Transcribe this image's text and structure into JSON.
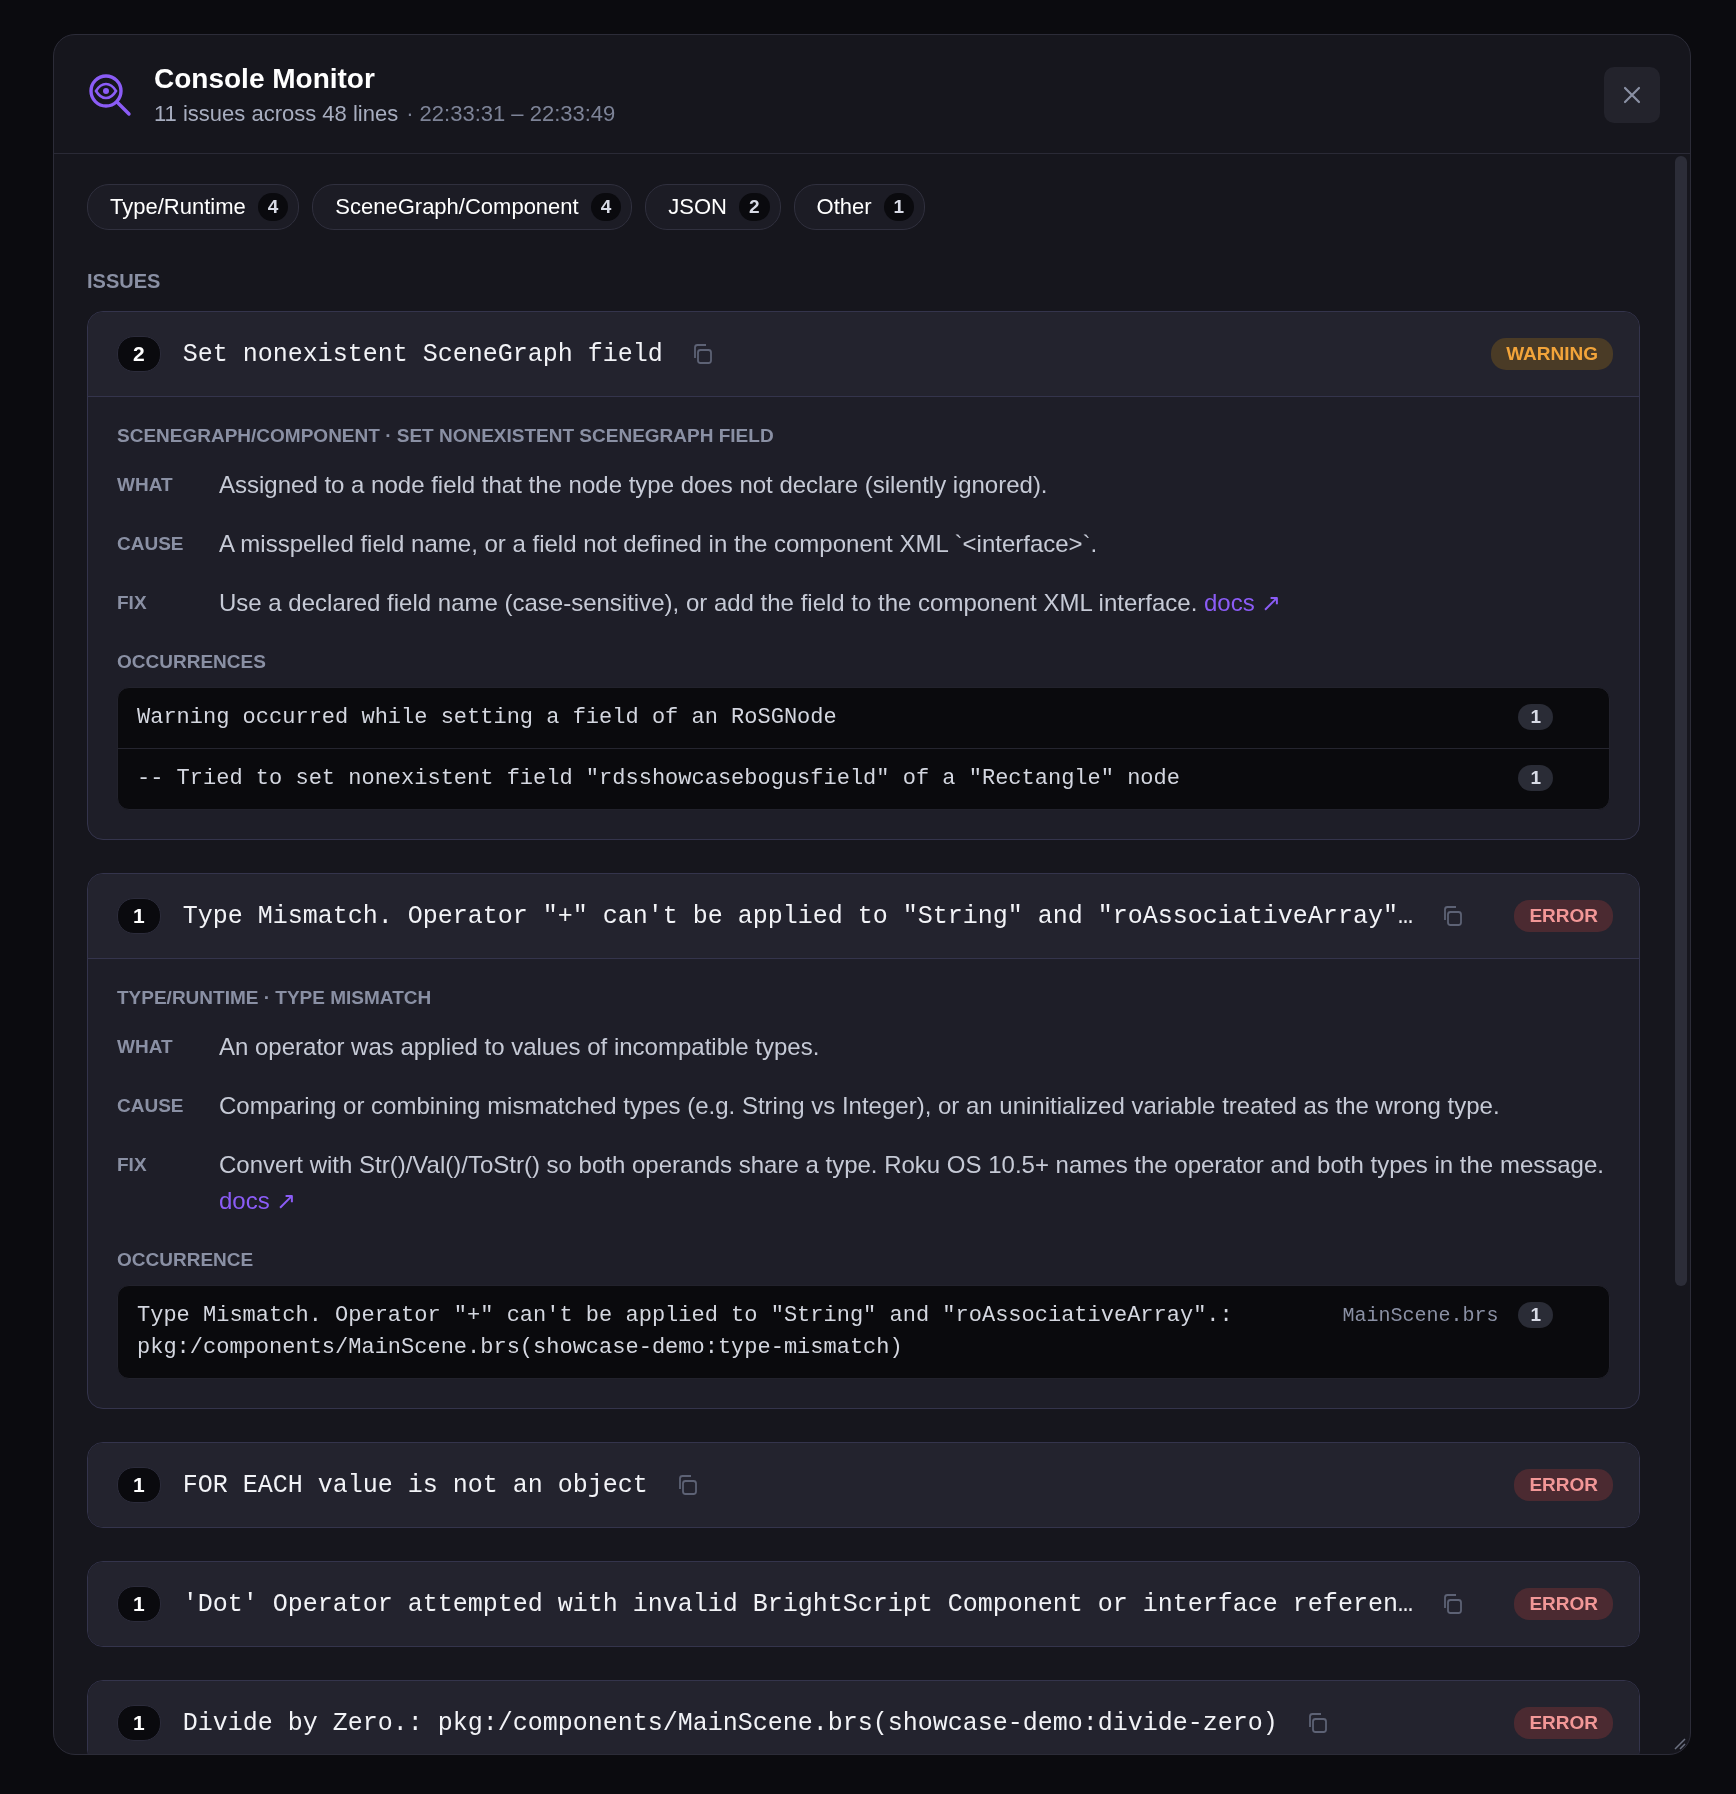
{
  "header": {
    "title": "Console Monitor",
    "summary": "11 issues across 48 lines",
    "time_range": "· 22:33:31 – 22:33:49"
  },
  "filters": [
    {
      "label": "Type/Runtime",
      "count": "4"
    },
    {
      "label": "SceneGraph/Component",
      "count": "4"
    },
    {
      "label": "JSON",
      "count": "2"
    },
    {
      "label": "Other",
      "count": "1"
    }
  ],
  "section_label": "ISSUES",
  "issues": [
    {
      "count": "2",
      "title": "Set nonexistent SceneGraph field",
      "kind": "warning",
      "severity": "WARNING",
      "expanded": true,
      "category": "SCENEGRAPH/COMPONENT · SET NONEXISTENT SCENEGRAPH FIELD",
      "details": [
        {
          "label": "WHAT",
          "text": "Assigned to a node field that the node type does not declare (silently ignored)."
        },
        {
          "label": "CAUSE",
          "text": "A misspelled field name, or a field not defined in the component XML `<interface>`."
        },
        {
          "label": "FIX",
          "text": "Use a declared field name (case-sensitive), or add the field to the component XML interface.",
          "link": "docs ↗"
        }
      ],
      "occurrences_label": "OCCURRENCES",
      "occurrences": [
        {
          "text": "Warning occurred while setting a field of an RoSGNode",
          "count": "1"
        },
        {
          "text": "-- Tried to set nonexistent field \"rdsshowcasebogusfield\" of a \"Rectangle\" node",
          "count": "1"
        }
      ]
    },
    {
      "count": "1",
      "title": "Type Mismatch. Operator \"+\" can't be applied to \"String\" and \"roAssociativeArray\"…",
      "kind": "error",
      "severity": "ERROR",
      "expanded": true,
      "category": "TYPE/RUNTIME · TYPE MISMATCH",
      "details": [
        {
          "label": "WHAT",
          "text": "An operator was applied to values of incompatible types."
        },
        {
          "label": "CAUSE",
          "text": "Comparing or combining mismatched types (e.g. String vs Integer), or an uninitialized variable treated as the wrong type."
        },
        {
          "label": "FIX",
          "text": "Convert with Str()/Val()/ToStr() so both operands share a type. Roku OS 10.5+ names the operator and both types in the message.",
          "link": "docs ↗"
        }
      ],
      "occurrences_label": "OCCURRENCE",
      "occurrences": [
        {
          "text": "Type Mismatch. Operator \"+\" can't be applied to \"String\" and \"roAssociativeArray\".: pkg:/components/MainScene.brs(showcase-demo:type-mismatch)",
          "file": "MainScene.brs",
          "count": "1"
        }
      ]
    },
    {
      "count": "1",
      "title": "FOR EACH value is not an object",
      "kind": "error",
      "severity": "ERROR",
      "expanded": false
    },
    {
      "count": "1",
      "title": "'Dot' Operator attempted with invalid BrightScript Component or interface referen…",
      "kind": "error",
      "severity": "ERROR",
      "expanded": false
    },
    {
      "count": "1",
      "title": "Divide by Zero.: pkg:/components/MainScene.brs(showcase-demo:divide-zero)",
      "kind": "error",
      "severity": "ERROR",
      "expanded": false
    }
  ]
}
